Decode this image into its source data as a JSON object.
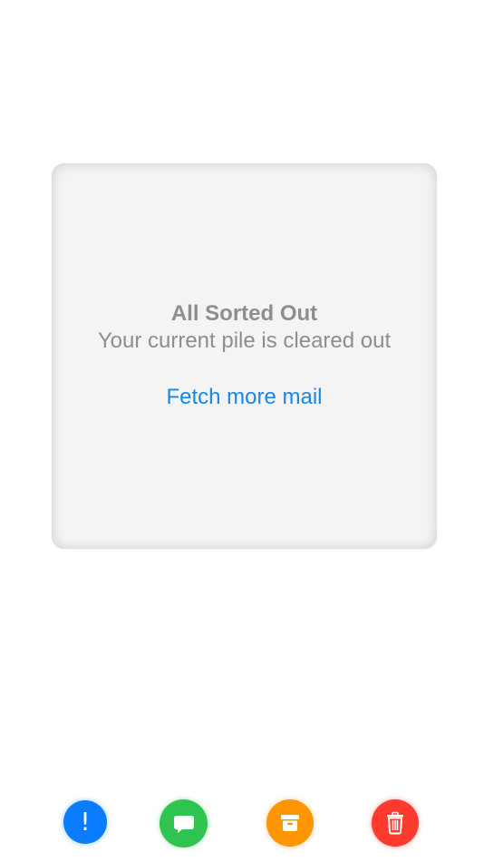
{
  "empty_state": {
    "title": "All Sorted Out",
    "subtitle": "Your current pile is cleared out",
    "action_label": "Fetch more mail"
  },
  "actions": [
    {
      "name": "flag",
      "icon": "exclamation-icon",
      "glyph": "!",
      "color": "#0a7cff"
    },
    {
      "name": "reply",
      "icon": "message-bubble-icon",
      "color": "#2fc44f"
    },
    {
      "name": "archive",
      "icon": "archive-box-icon",
      "color": "#ff9500"
    },
    {
      "name": "delete",
      "icon": "trash-icon",
      "color": "#ff3b30"
    }
  ],
  "colors": {
    "card_background": "#f4f4f4",
    "muted_text": "#8e8e8e",
    "link": "#1a86e6"
  }
}
